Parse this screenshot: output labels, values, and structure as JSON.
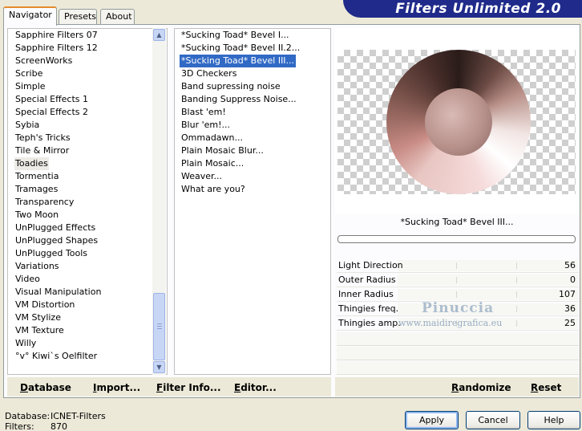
{
  "tabs": [
    "Navigator",
    "Presets",
    "About"
  ],
  "app_title": "Filters Unlimited 2.0",
  "categories": [
    "Sapphire Filters 07",
    "Sapphire Filters 12",
    "ScreenWorks",
    "Scribe",
    "Simple",
    "Special Effects 1",
    "Special Effects 2",
    "Sybia",
    "Teph's Tricks",
    "Tile & Mirror",
    "Toadies",
    "Tormentia",
    "Tramages",
    "Transparency",
    "Two Moon",
    "UnPlugged Effects",
    "UnPlugged Shapes",
    "UnPlugged Tools",
    "Variations",
    "Video",
    "Visual Manipulation",
    "VM Distortion",
    "VM Stylize",
    "VM Texture",
    "Willy",
    "°v° Kiwi`s Oelfilter"
  ],
  "selected_category": "Toadies",
  "filters": [
    "*Sucking Toad*  Bevel I...",
    "*Sucking Toad*  Bevel II.2...",
    "*Sucking Toad*  Bevel III...",
    "3D Checkers",
    "Band supressing noise",
    "Banding Suppress Noise...",
    "Blast 'em!",
    "Blur 'em!...",
    "Ommadawn...",
    "Plain Mosaic Blur...",
    "Plain Mosaic...",
    "Weaver...",
    "What are you?"
  ],
  "selected_filter": "*Sucking Toad*  Bevel III...",
  "preview_filter_name": "*Sucking Toad*  Bevel III...",
  "params": [
    {
      "label": "Light Direction",
      "value": "56"
    },
    {
      "label": "Outer Radius",
      "value": "0"
    },
    {
      "label": "Inner Radius",
      "value": "107"
    },
    {
      "label": "Thingies freq.",
      "value": "36"
    },
    {
      "label": "Thingies amp.",
      "value": "25"
    }
  ],
  "watermark": {
    "name": "Pinuccia",
    "url": "www.maidiregrafica.eu"
  },
  "links": {
    "database": "Database",
    "import": "Import...",
    "filter_info": "Filter Info...",
    "editor": "Editor...",
    "randomize": "Randomize",
    "reset": "Reset"
  },
  "footer": {
    "database_label": "Database:",
    "database_value": "ICNET-Filters",
    "filters_label": "Filters:",
    "filters_value": "870"
  },
  "buttons": {
    "apply": "Apply",
    "cancel": "Cancel",
    "help": "Help"
  },
  "icons": {
    "scroll_up": "chevron-up-icon",
    "scroll_down": "chevron-down-icon"
  }
}
